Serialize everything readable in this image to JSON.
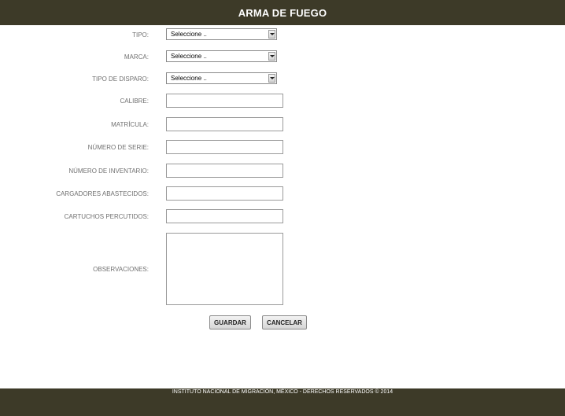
{
  "header": {
    "title": "ARMA DE FUEGO"
  },
  "form": {
    "tipo": {
      "label": "TIPO:",
      "value": "Seleccione .."
    },
    "marca": {
      "label": "MARCA:",
      "value": "Seleccione .."
    },
    "tipo_disparo": {
      "label": "TIPO DE DISPARO:",
      "value": "Seleccione .."
    },
    "calibre": {
      "label": "CALIBRE:",
      "value": ""
    },
    "matricula": {
      "label": "MATRÍCULA:",
      "value": ""
    },
    "numero_serie": {
      "label": "NÚMERO DE SERIE:",
      "value": ""
    },
    "numero_inventario": {
      "label": "NÚMERO DE INVENTARIO:",
      "value": ""
    },
    "cargadores": {
      "label": "CARGADORES ABASTECIDOS:",
      "value": ""
    },
    "cartuchos": {
      "label": "CARTUCHOS PERCUTIDOS:",
      "value": ""
    },
    "observaciones": {
      "label": "OBSERVACIONES:",
      "value": ""
    }
  },
  "buttons": {
    "guardar": "GUARDAR",
    "cancelar": "CANCELAR"
  },
  "footer": {
    "text": "INSTITUTO NACIONAL DE MIGRACIÓN, MÉXICO - DERECHOS RESERVADOS © 2014"
  },
  "colors": {
    "bar": "#3d3a28",
    "label": "#707070"
  },
  "icons": {
    "select_arrow": "chevron-down-icon"
  }
}
